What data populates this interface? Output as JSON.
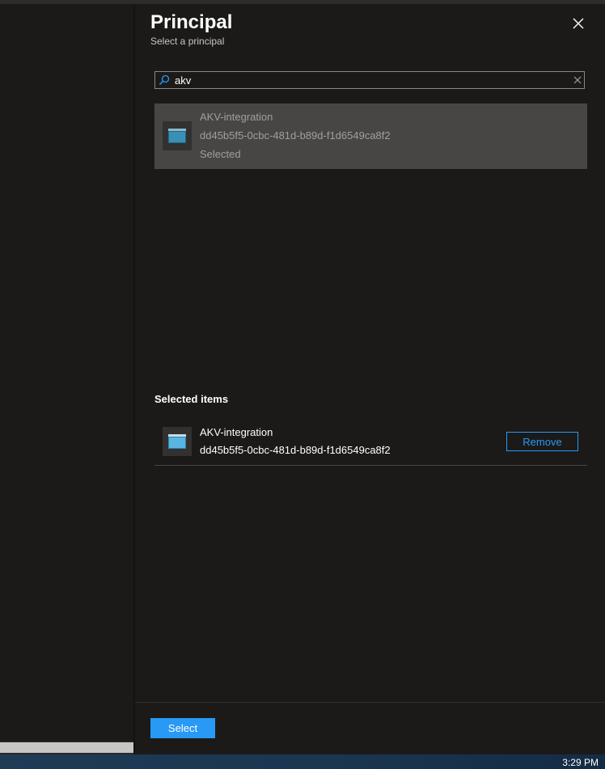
{
  "panel": {
    "title": "Principal",
    "subtitle": "Select a principal"
  },
  "search": {
    "value": "akv"
  },
  "results": [
    {
      "name": "AKV-integration",
      "id": "dd45b5f5-0cbc-481d-b89d-f1d6549ca8f2",
      "status": "Selected"
    }
  ],
  "selected_items": {
    "heading": "Selected items",
    "items": [
      {
        "name": "AKV-integration",
        "id": "dd45b5f5-0cbc-481d-b89d-f1d6549ca8f2",
        "remove_label": "Remove"
      }
    ]
  },
  "footer": {
    "select_label": "Select"
  },
  "taskbar": {
    "time": "3:29 PM"
  },
  "icons": {
    "close": "close-icon",
    "search": "search-icon",
    "clear": "clear-icon",
    "app": "app-registration-icon"
  },
  "colors": {
    "accent": "#2899f5",
    "panel_bg": "#1b1a19",
    "highlight_bg": "#484644"
  }
}
